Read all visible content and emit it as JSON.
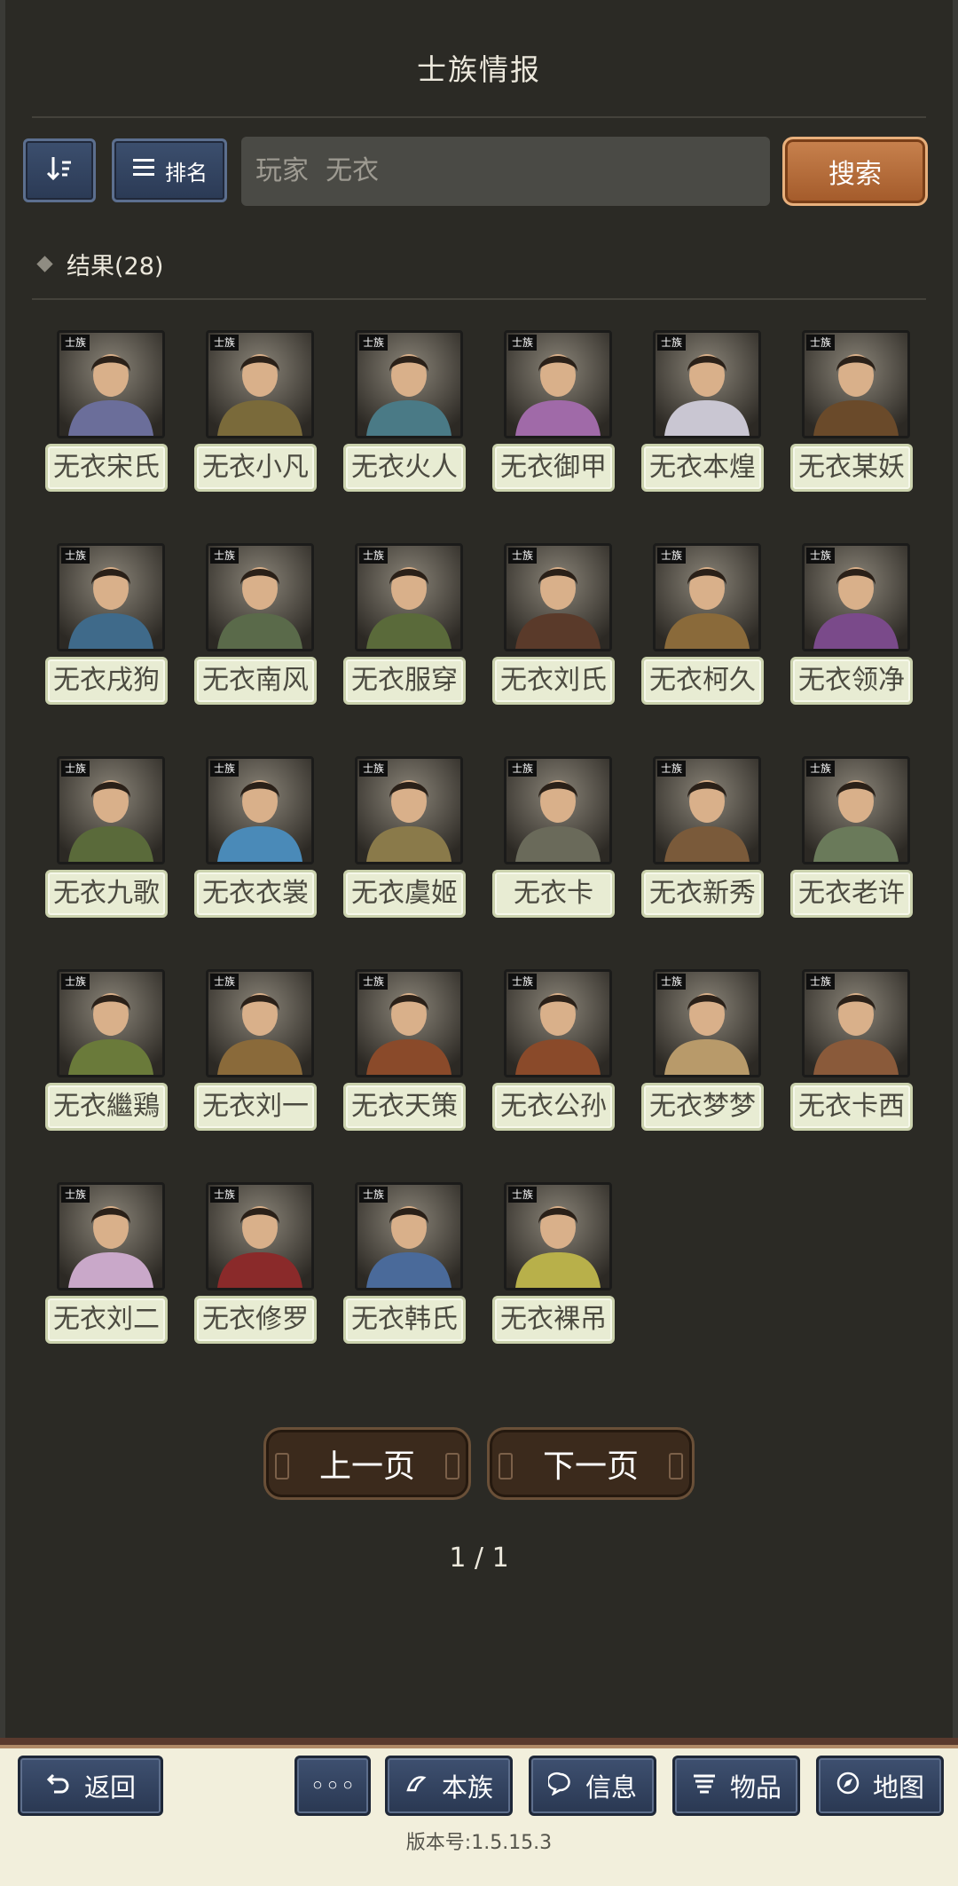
{
  "header": {
    "title": "士族情报"
  },
  "toolbar": {
    "rank_label": "排名",
    "search_value": "玩家  无衣",
    "search_button": "搜索"
  },
  "results": {
    "label": "结果(28)"
  },
  "portrait_tag": "士族",
  "members": [
    {
      "name": "无衣宋氏",
      "color": "#6b6e9a"
    },
    {
      "name": "无衣小凡",
      "color": "#7a6a3a"
    },
    {
      "name": "无衣火人",
      "color": "#4a7a86"
    },
    {
      "name": "无衣御甲",
      "color": "#a06aa8"
    },
    {
      "name": "无衣本煌",
      "color": "#c9c6d2"
    },
    {
      "name": "无衣某妖",
      "color": "#6a4a2a"
    },
    {
      "name": "无衣戌狗",
      "color": "#3f6a8a"
    },
    {
      "name": "无衣南风",
      "color": "#5a6a4a"
    },
    {
      "name": "无衣服穿",
      "color": "#5a6a3a"
    },
    {
      "name": "无衣刘氏",
      "color": "#5a3a2a"
    },
    {
      "name": "无衣柯久",
      "color": "#8a6a3a"
    },
    {
      "name": "无衣领净",
      "color": "#7a4a8a"
    },
    {
      "name": "无衣九歌",
      "color": "#5a6a3a"
    },
    {
      "name": "无衣衣裳",
      "color": "#4a8ab8"
    },
    {
      "name": "无衣虞姬",
      "color": "#8a7a4a"
    },
    {
      "name": "无衣卡",
      "color": "#6a6a5a"
    },
    {
      "name": "无衣新秀",
      "color": "#7a5a3a"
    },
    {
      "name": "无衣老许",
      "color": "#6a7a5a"
    },
    {
      "name": "无衣繼鶏",
      "color": "#6a7a3a"
    },
    {
      "name": "无衣刘一",
      "color": "#8a6a3a"
    },
    {
      "name": "无衣天策",
      "color": "#8a4a2a"
    },
    {
      "name": "无衣公孙",
      "color": "#8a4a2a"
    },
    {
      "name": "无衣梦梦",
      "color": "#b89a6a"
    },
    {
      "name": "无衣卡西",
      "color": "#8a5a3a"
    },
    {
      "name": "无衣刘二",
      "color": "#c9a8c9"
    },
    {
      "name": "无衣修罗",
      "color": "#8a2a2a"
    },
    {
      "name": "无衣韩氏",
      "color": "#4a6a9a"
    },
    {
      "name": "无衣裸吊",
      "color": "#b8b04a"
    }
  ],
  "pagination": {
    "prev": "上一页",
    "next": "下一页",
    "indicator": "1 / 1"
  },
  "bottom_nav": {
    "back": "返回",
    "more": "◦◦◦",
    "clan": "本族",
    "info": "信息",
    "items": "物品",
    "map": "地图"
  },
  "version": "版本号:1.5.15.3"
}
